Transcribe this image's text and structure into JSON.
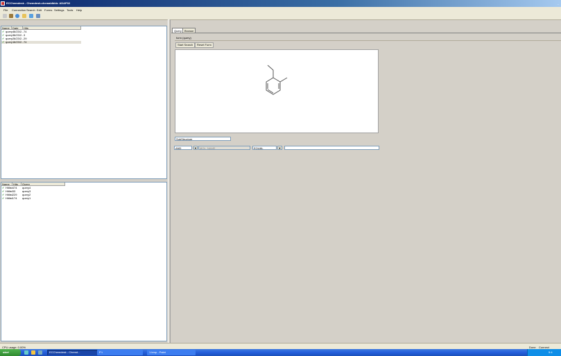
{
  "window": {
    "title": "ECChemdesk - Chemdesk.chemaldbkb: ADAP02",
    "controls": "_"
  },
  "menu": [
    "File",
    "Connection",
    "Search",
    "Edit",
    "Forms",
    "Settings",
    "Tools",
    "Help"
  ],
  "toolbar": {
    "icons": [
      "new-icon",
      "edit-icon",
      "connect-icon",
      "open-folder-icon",
      "refresh-icon",
      "database-icon"
    ]
  },
  "queries_panel": {
    "columns": [
      "Name",
      "Date",
      "Hits"
    ],
    "rows": [
      {
        "name": "query4",
        "date": "6/23/2...",
        "hits": "74",
        "selected": false
      },
      {
        "name": "query3",
        "date": "6/23/2...",
        "hits": "3",
        "selected": false
      },
      {
        "name": "query2",
        "date": "6/23/2...",
        "hits": "29",
        "selected": false
      },
      {
        "name": "query1",
        "date": "6/23/2...",
        "hits": "74",
        "selected": true
      }
    ]
  },
  "hitlists_panel": {
    "columns": [
      "Name",
      "Hits",
      "Query"
    ],
    "rows": [
      {
        "name": "Hitlist4",
        "hits": "74",
        "query": "query4"
      },
      {
        "name": "Hitlist3",
        "hits": "3",
        "query": "query3"
      },
      {
        "name": "Hitlist2",
        "hits": "29",
        "query": "query2"
      },
      {
        "name": "Hitlist1",
        "hits": "74",
        "query": "query1"
      }
    ]
  },
  "tabs": [
    {
      "label": "Query",
      "active": true
    },
    {
      "label": "Browse",
      "active": false
    }
  ],
  "query_form": {
    "form_name": "form (query)",
    "start_search": "Start Search",
    "reset_form": "Reset Form",
    "search_type": "SubStructure",
    "logic": "AND",
    "field_name": "MOL_NAME",
    "operator": "EQUAL",
    "value": ""
  },
  "status": {
    "left": "CPU usage: 0.00%",
    "right": "Done",
    "right2": "Connect"
  },
  "taskbar": {
    "start": "start",
    "tasks": [
      {
        "label": "ECChemdesk - Chemd...",
        "active": true
      },
      {
        "label": "P:\\",
        "active": false
      },
      {
        "label": "1.bmp - Paint",
        "active": false
      }
    ],
    "clock": "5:4"
  },
  "colors": {
    "titlebar": "#0a246a",
    "taskbar": "#245edb",
    "start": "#2f8a2f",
    "panel": "#d4d0c8"
  }
}
